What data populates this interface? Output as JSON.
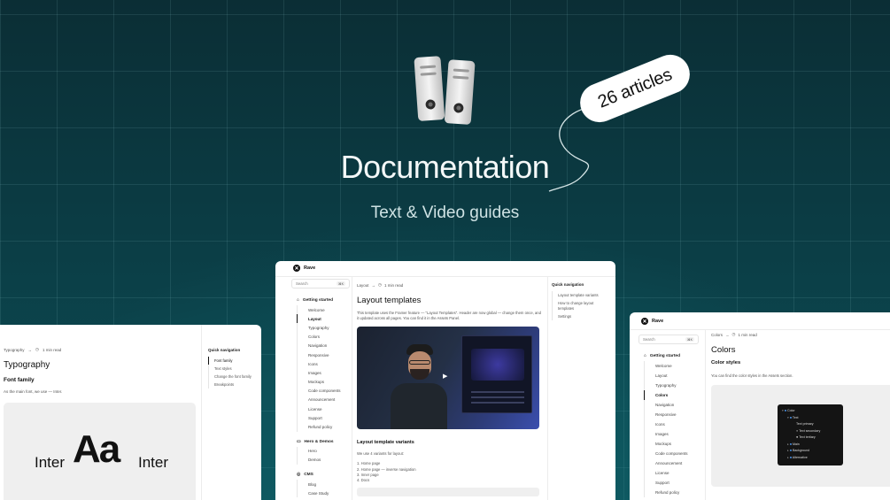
{
  "hero": {
    "title": "Documentation",
    "subtitle": "Text & Video guides",
    "badge": "26 articles",
    "icon": "binder-files-icon"
  },
  "center_card": {
    "brand": "Rave",
    "search": {
      "placeholder": "Search",
      "shortcut": "⌘K"
    },
    "breadcrumb": {
      "section": "Layout",
      "separator": "→",
      "read_time": "1 min read"
    },
    "sidebar": {
      "groups": [
        {
          "label": "Getting started",
          "items": [
            "Welcome",
            "Layout",
            "Typography",
            "Colors",
            "Navigation",
            "Responsive",
            "Icons",
            "Images",
            "Mockups",
            "Code components",
            "Announcement",
            "License",
            "Support",
            "Refund policy"
          ],
          "active": "Layout"
        },
        {
          "label": "Hero & Demos",
          "items": [
            "Hero",
            "Demos"
          ]
        },
        {
          "label": "CMS",
          "items": [
            "Blog",
            "Case Study"
          ]
        }
      ]
    },
    "article": {
      "title": "Layout templates",
      "intro": "This template uses the Framer feature — \"Layout Templates\". Header are now global — change them once, and it updated across all pages. You can find it in the Assets Panel.",
      "section_title": "Layout template variants",
      "section_intro": "We use 4 variants for layout:",
      "variants": [
        "1. Home page",
        "2. Home page — inverse navigation",
        "3. Inner page",
        "4. Docs"
      ]
    },
    "quick_nav": {
      "title": "Quick navigation",
      "items": [
        "Layout template variants",
        "How to change layout templates",
        "Settings"
      ]
    }
  },
  "left_card": {
    "breadcrumb": {
      "section": "Typography",
      "separator": "→",
      "read_time": "1 min read"
    },
    "article": {
      "title": "Typography",
      "subtitle": "Font family",
      "text": "As the main font, we use — Inter.",
      "specimen": {
        "left": "Inter",
        "center": "Aa",
        "right": "Inter"
      }
    },
    "quick_nav": {
      "title": "Quick navigation",
      "items": [
        "Font family",
        "Text styles",
        "Change the font family",
        "Breakpoints"
      ]
    }
  },
  "right_card": {
    "brand": "Rave",
    "search": {
      "placeholder": "Search",
      "shortcut": "⌘K"
    },
    "breadcrumb": {
      "section": "Colors",
      "separator": "→",
      "read_time": "1 min read"
    },
    "sidebar": {
      "group": "Getting started",
      "items": [
        "Welcome",
        "Layout",
        "Typography",
        "Colors",
        "Navigation",
        "Responsive",
        "Icons",
        "Images",
        "Mockups",
        "Code components",
        "Announcement",
        "License",
        "Support",
        "Refund policy"
      ],
      "active": "Colors"
    },
    "article": {
      "title": "Colors",
      "subtitle": "Color styles",
      "text": "You can find the color styles in the Assets section."
    },
    "color_panel": {
      "rows": [
        "Color",
        "Text",
        "Text primary",
        "Text secondary",
        "Text tertiary",
        "Main",
        "Background",
        "Alternative"
      ]
    }
  },
  "colors": {
    "accent": "#0b3c44",
    "card_bg": "#ffffff",
    "dark_panel": "#141414"
  }
}
